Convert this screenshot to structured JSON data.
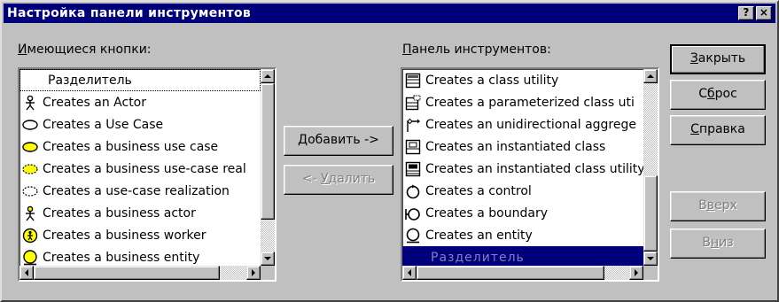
{
  "window": {
    "title": "Настройка панели инструментов",
    "help_button": "?",
    "close_button": "×"
  },
  "available": {
    "label_accel": "И",
    "label_rest": "меющиеся кнопки:",
    "items": [
      {
        "text": "Разделитель",
        "icon": "none",
        "separator": true
      },
      {
        "text": "Creates an Actor",
        "icon": "actor-icon"
      },
      {
        "text": "Creates a Use Case",
        "icon": "use-case-icon"
      },
      {
        "text": "Creates a business use case",
        "icon": "business-use-case-icon"
      },
      {
        "text": "Creates a business use-case real",
        "icon": "business-use-case-realization-icon"
      },
      {
        "text": "Creates a use-case realization",
        "icon": "use-case-realization-icon"
      },
      {
        "text": "Creates a business actor",
        "icon": "business-actor-icon"
      },
      {
        "text": "Creates a business worker",
        "icon": "business-worker-icon"
      },
      {
        "text": "Creates a business entity",
        "icon": "business-entity-icon"
      }
    ]
  },
  "toolbar": {
    "label_accel": "П",
    "label_rest": "анель инструментов:",
    "items": [
      {
        "text": "Creates a class utility",
        "icon": "class-utility-icon"
      },
      {
        "text": "Creates a parameterized class uti",
        "icon": "parameterized-class-icon"
      },
      {
        "text": "Creates an unidirectional aggrege",
        "icon": "aggregation-icon"
      },
      {
        "text": "Creates an instantiated class",
        "icon": "instantiated-class-icon"
      },
      {
        "text": "Creates an instantiated class utility",
        "icon": "instantiated-class-utility-icon"
      },
      {
        "text": "Creates a control",
        "icon": "control-icon"
      },
      {
        "text": "Creates a boundary",
        "icon": "boundary-icon"
      },
      {
        "text": "Creates an entity",
        "icon": "entity-icon"
      },
      {
        "text": "Разделитель",
        "icon": "none",
        "separator": true,
        "selected": true
      }
    ]
  },
  "buttons": {
    "add_accel": "Д",
    "add_rest": "обавить ->",
    "remove_pre": "<- ",
    "remove_accel": "У",
    "remove_rest": "далить",
    "close_accel": "З",
    "close_rest": "акрыть",
    "reset_pre": "С",
    "reset_accel": "б",
    "reset_rest": "рос",
    "help_accel": "С",
    "help_rest": "правка",
    "up_pre": "В",
    "up_accel": "в",
    "up_rest": "ерх",
    "down_pre": "В",
    "down_accel": "н",
    "down_rest": "из"
  },
  "colors": {
    "title_bar": "#00007b",
    "face": "#c0c0c0",
    "selection": "#00007b",
    "icon_yellow": "#ffff00"
  }
}
